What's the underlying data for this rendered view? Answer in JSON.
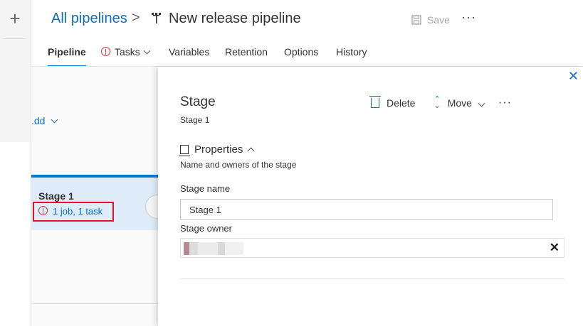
{
  "rail": {
    "add_label": "+"
  },
  "header": {
    "breadcrumb": "All pipelines",
    "breadcrumb_separator": ">",
    "title": "New release pipeline",
    "save_label": "Save",
    "more_label": "···"
  },
  "tabs": [
    {
      "label": "Pipeline",
      "active": true
    },
    {
      "label": "Tasks",
      "error": true
    },
    {
      "label": "Variables"
    },
    {
      "label": "Retention"
    },
    {
      "label": "Options"
    },
    {
      "label": "History"
    }
  ],
  "canvas": {
    "add_label": ".dd",
    "stage_name": "Stage 1",
    "stage_summary": "1 job, 1 task"
  },
  "panel": {
    "title": "Stage",
    "subtitle": "Stage 1",
    "delete_label": "Delete",
    "move_label": "Move",
    "more_label": "···",
    "close_label": "✕",
    "properties_label": "Properties",
    "properties_desc": "Name and owners of the stage",
    "stage_name_label": "Stage name",
    "stage_name_value": "Stage 1",
    "stage_owner_label": "Stage owner",
    "clear_label": "✕"
  },
  "colors": {
    "accent": "#0078d4",
    "link": "#106ebe",
    "error": "#d13438",
    "highlight_box": "#e81123"
  }
}
